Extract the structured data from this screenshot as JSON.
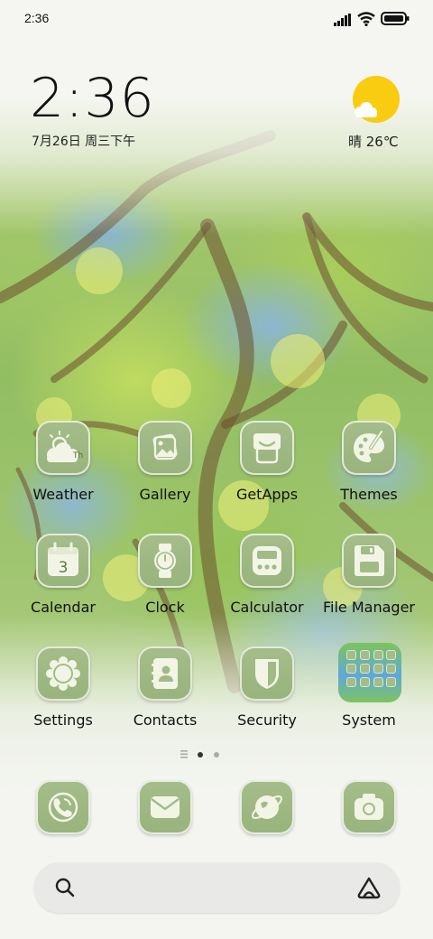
{
  "status_bar": {
    "time": "2:36",
    "icons": [
      "signal-icon",
      "wifi-icon",
      "battery-icon"
    ]
  },
  "clock_widget": {
    "time": "2:36",
    "date": "7月26日 周三下午",
    "weather": "晴 26℃",
    "weather_icon": "sun-cloud-icon"
  },
  "apps": [
    {
      "label": "Weather",
      "icon": "weather-icon"
    },
    {
      "label": "Gallery",
      "icon": "gallery-icon"
    },
    {
      "label": "GetApps",
      "icon": "getapps-icon"
    },
    {
      "label": "Themes",
      "icon": "themes-icon"
    },
    {
      "label": "Calendar",
      "icon": "calendar-icon",
      "badge_text": "3"
    },
    {
      "label": "Clock",
      "icon": "clock-icon"
    },
    {
      "label": "Calculator",
      "icon": "calculator-icon"
    },
    {
      "label": "File Manager",
      "icon": "file-manager-icon"
    },
    {
      "label": "Settings",
      "icon": "settings-icon"
    },
    {
      "label": "Contacts",
      "icon": "contacts-icon"
    },
    {
      "label": "Security",
      "icon": "security-icon"
    },
    {
      "label": "System",
      "icon": "system-folder-icon"
    }
  ],
  "weather_icon_text": "Th",
  "pager": {
    "pages": 2,
    "current": 1
  },
  "dock": [
    {
      "icon": "phone-icon"
    },
    {
      "icon": "messages-icon"
    },
    {
      "icon": "browser-icon"
    },
    {
      "icon": "camera-icon"
    }
  ],
  "search": {
    "left_icon": "search-icon",
    "right_icon": "assistant-icon"
  },
  "colors": {
    "icon_bg": "#a2bb86",
    "glyph": "#f2f5e6",
    "pager_active": "#333333",
    "pager_inactive": "#aaaaaa"
  }
}
